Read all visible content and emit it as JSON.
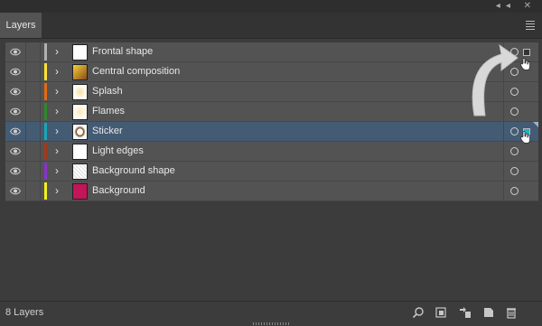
{
  "panel": {
    "tab_label": "Layers",
    "status_count": "8 Layers"
  },
  "layers": [
    {
      "name": "Frontal shape",
      "color": "#b0b0b0",
      "selected": false
    },
    {
      "name": "Central composition",
      "color": "#ffe033",
      "selected": false
    },
    {
      "name": "Splash",
      "color": "#e36a10",
      "selected": false
    },
    {
      "name": "Flames",
      "color": "#2c8a2c",
      "selected": false
    },
    {
      "name": "Sticker",
      "color": "#19a7b5",
      "selected": true
    },
    {
      "name": "Light edges",
      "color": "#a3381a",
      "selected": false
    },
    {
      "name": "Background shape",
      "color": "#8a33c8",
      "selected": false
    },
    {
      "name": "Background",
      "color": "#f2f01c",
      "selected": false
    }
  ],
  "icons": {
    "visibility": "eye-icon",
    "expand": "chevron-right-icon",
    "target": "target-circle-icon",
    "bottom_actions": [
      "search-icon",
      "collect-for-export-icon",
      "make-clipping-mask-icon",
      "new-layer-icon",
      "trash-icon"
    ]
  }
}
